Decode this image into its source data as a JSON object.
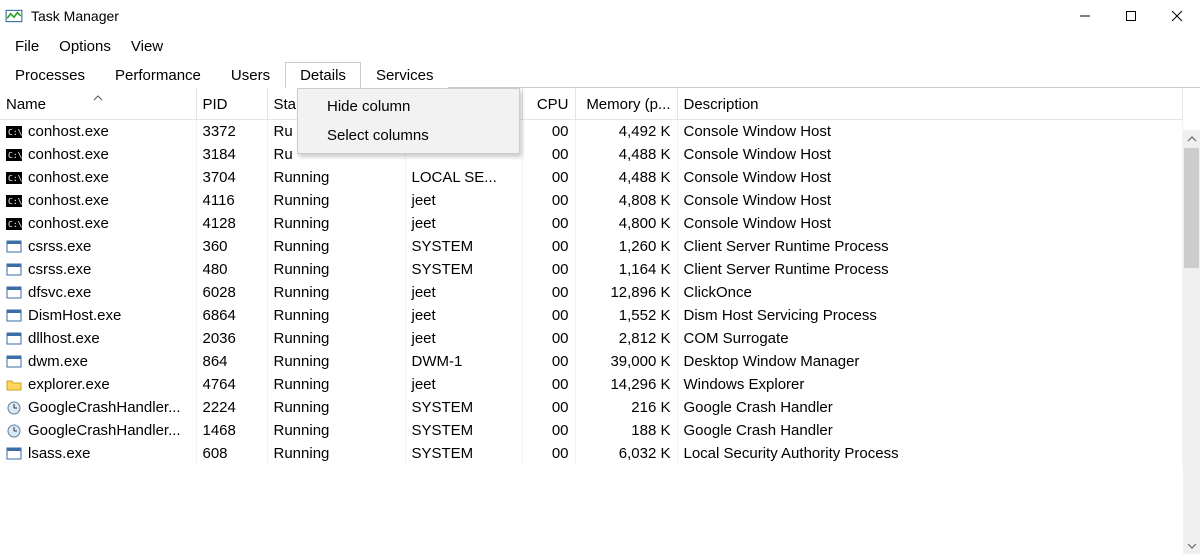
{
  "title": "Task Manager",
  "menu": {
    "file": "File",
    "options": "Options",
    "view": "View"
  },
  "tabs": {
    "processes": "Processes",
    "performance": "Performance",
    "users": "Users",
    "details": "Details",
    "services": "Services",
    "active": "details"
  },
  "columns": {
    "name": "Name",
    "pid": "PID",
    "status": "Sta",
    "user": "",
    "cpu": "CPU",
    "memory": "Memory (p...",
    "description": "Description"
  },
  "context_menu": {
    "hide": "Hide column",
    "select": "Select columns"
  },
  "rows": [
    {
      "icon": "console",
      "name": "conhost.exe",
      "pid": "3372",
      "status": "Ru",
      "user": "",
      "cpu": "00",
      "mem": "4,492 K",
      "desc": "Console Window Host"
    },
    {
      "icon": "console",
      "name": "conhost.exe",
      "pid": "3184",
      "status": "Ru",
      "user": "",
      "cpu": "00",
      "mem": "4,488 K",
      "desc": "Console Window Host"
    },
    {
      "icon": "console",
      "name": "conhost.exe",
      "pid": "3704",
      "status": "Running",
      "user": "LOCAL SE...",
      "cpu": "00",
      "mem": "4,488 K",
      "desc": "Console Window Host"
    },
    {
      "icon": "console",
      "name": "conhost.exe",
      "pid": "4116",
      "status": "Running",
      "user": "jeet",
      "cpu": "00",
      "mem": "4,808 K",
      "desc": "Console Window Host"
    },
    {
      "icon": "console",
      "name": "conhost.exe",
      "pid": "4128",
      "status": "Running",
      "user": "jeet",
      "cpu": "00",
      "mem": "4,800 K",
      "desc": "Console Window Host"
    },
    {
      "icon": "app",
      "name": "csrss.exe",
      "pid": "360",
      "status": "Running",
      "user": "SYSTEM",
      "cpu": "00",
      "mem": "1,260 K",
      "desc": "Client Server Runtime Process"
    },
    {
      "icon": "app",
      "name": "csrss.exe",
      "pid": "480",
      "status": "Running",
      "user": "SYSTEM",
      "cpu": "00",
      "mem": "1,164 K",
      "desc": "Client Server Runtime Process"
    },
    {
      "icon": "app",
      "name": "dfsvc.exe",
      "pid": "6028",
      "status": "Running",
      "user": "jeet",
      "cpu": "00",
      "mem": "12,896 K",
      "desc": "ClickOnce"
    },
    {
      "icon": "app",
      "name": "DismHost.exe",
      "pid": "6864",
      "status": "Running",
      "user": "jeet",
      "cpu": "00",
      "mem": "1,552 K",
      "desc": "Dism Host Servicing Process"
    },
    {
      "icon": "app",
      "name": "dllhost.exe",
      "pid": "2036",
      "status": "Running",
      "user": "jeet",
      "cpu": "00",
      "mem": "2,812 K",
      "desc": "COM Surrogate"
    },
    {
      "icon": "app",
      "name": "dwm.exe",
      "pid": "864",
      "status": "Running",
      "user": "DWM-1",
      "cpu": "00",
      "mem": "39,000 K",
      "desc": "Desktop Window Manager"
    },
    {
      "icon": "explorer",
      "name": "explorer.exe",
      "pid": "4764",
      "status": "Running",
      "user": "jeet",
      "cpu": "00",
      "mem": "14,296 K",
      "desc": "Windows Explorer"
    },
    {
      "icon": "clock",
      "name": "GoogleCrashHandler...",
      "pid": "2224",
      "status": "Running",
      "user": "SYSTEM",
      "cpu": "00",
      "mem": "216 K",
      "desc": "Google Crash Handler"
    },
    {
      "icon": "clock",
      "name": "GoogleCrashHandler...",
      "pid": "1468",
      "status": "Running",
      "user": "SYSTEM",
      "cpu": "00",
      "mem": "188 K",
      "desc": "Google Crash Handler"
    },
    {
      "icon": "app",
      "name": "lsass.exe",
      "pid": "608",
      "status": "Running",
      "user": "SYSTEM",
      "cpu": "00",
      "mem": "6,032 K",
      "desc": "Local Security Authority Process"
    }
  ]
}
